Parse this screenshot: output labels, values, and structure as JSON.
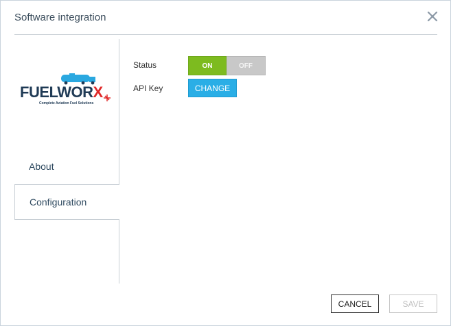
{
  "dialog": {
    "title": "Software integration",
    "close_icon": "close-icon"
  },
  "sidebar": {
    "logo": {
      "wordmark": "FUELWORX",
      "tagline": "Complete Aviation Fuel Solutions",
      "colors": {
        "text": "#1f3a55",
        "accent": "#e02828",
        "truck": "#2aa8e0"
      }
    },
    "items": [
      {
        "label": "About",
        "active": false
      },
      {
        "label": "Configuration",
        "active": true
      }
    ]
  },
  "config": {
    "status_label": "Status",
    "status_toggle": {
      "on_label": "ON",
      "off_label": "OFF",
      "value": "ON"
    },
    "api_key_label": "API Key",
    "change_label": "CHANGE"
  },
  "footer": {
    "cancel_label": "CANCEL",
    "save_label": "SAVE",
    "save_enabled": false
  },
  "colors": {
    "toggle_on": "#7dbb1f",
    "toggle_off": "#c8c8c8",
    "primary_button": "#2aaee6"
  }
}
